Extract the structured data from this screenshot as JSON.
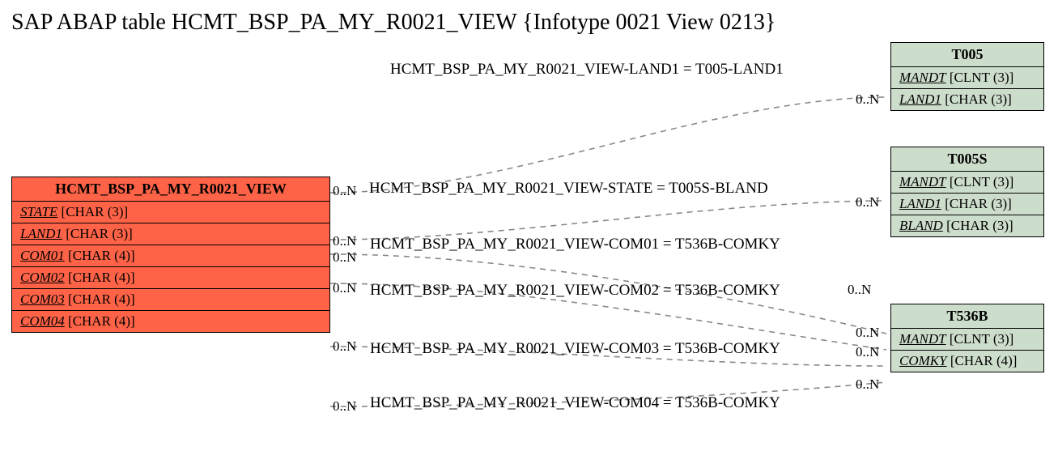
{
  "title": "SAP ABAP table HCMT_BSP_PA_MY_R0021_VIEW {Infotype 0021 View 0213}",
  "main": {
    "name": "HCMT_BSP_PA_MY_R0021_VIEW",
    "fields": [
      {
        "name": "STATE",
        "type": "[CHAR (3)]"
      },
      {
        "name": "LAND1",
        "type": "[CHAR (3)]"
      },
      {
        "name": "COM01",
        "type": "[CHAR (4)]"
      },
      {
        "name": "COM02",
        "type": "[CHAR (4)]"
      },
      {
        "name": "COM03",
        "type": "[CHAR (4)]"
      },
      {
        "name": "COM04",
        "type": "[CHAR (4)]"
      }
    ]
  },
  "refs": {
    "t005": {
      "name": "T005",
      "fields": [
        {
          "name": "MANDT",
          "type": "[CLNT (3)]"
        },
        {
          "name": "LAND1",
          "type": "[CHAR (3)]"
        }
      ]
    },
    "t005s": {
      "name": "T005S",
      "fields": [
        {
          "name": "MANDT",
          "type": "[CLNT (3)]"
        },
        {
          "name": "LAND1",
          "type": "[CHAR (3)]"
        },
        {
          "name": "BLAND",
          "type": "[CHAR (3)]"
        }
      ]
    },
    "t536b": {
      "name": "T536B",
      "fields": [
        {
          "name": "MANDT",
          "type": "[CLNT (3)]"
        },
        {
          "name": "COMKY",
          "type": "[CHAR (4)]"
        }
      ]
    }
  },
  "relations": [
    {
      "label": "HCMT_BSP_PA_MY_R0021_VIEW-LAND1 = T005-LAND1"
    },
    {
      "label": "HCMT_BSP_PA_MY_R0021_VIEW-STATE = T005S-BLAND"
    },
    {
      "label": "HCMT_BSP_PA_MY_R0021_VIEW-COM01 = T536B-COMKY"
    },
    {
      "label": "HCMT_BSP_PA_MY_R0021_VIEW-COM02 = T536B-COMKY"
    },
    {
      "label": "HCMT_BSP_PA_MY_R0021_VIEW-COM03 = T536B-COMKY"
    },
    {
      "label": "HCMT_BSP_PA_MY_R0021_VIEW-COM04 = T536B-COMKY"
    }
  ],
  "card": "0..N"
}
